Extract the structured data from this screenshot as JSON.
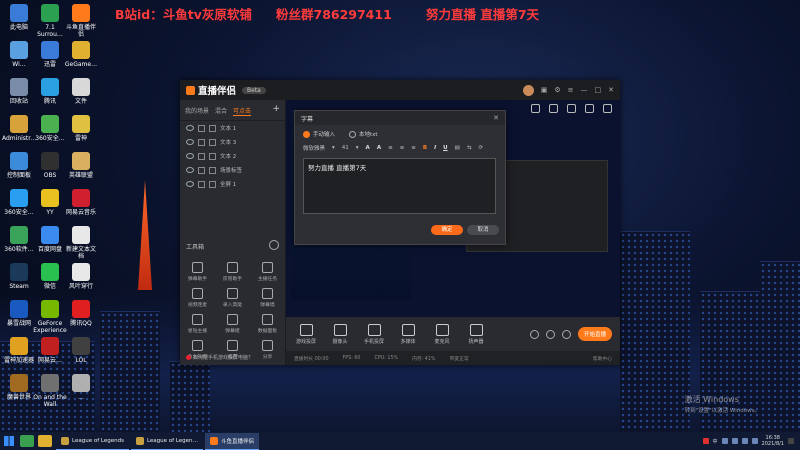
{
  "banner": {
    "text1": "B站id：斗鱼tv灰原软铺",
    "text2": "粉丝群786297411",
    "text3": "努力直播 直播第7天"
  },
  "desktop_icons": [
    {
      "label": "此电脑",
      "color": "#3b7bd8"
    },
    {
      "label": "Wi…",
      "color": "#5aa0e0"
    },
    {
      "label": "回收站",
      "color": "#7a8ca8"
    },
    {
      "label": "Administr…",
      "color": "#d8a23a"
    },
    {
      "label": "控制面板",
      "color": "#3b8bd8"
    },
    {
      "label": "360安全…",
      "color": "#2a9ef0"
    },
    {
      "label": "360软件…",
      "color": "#3aa35a"
    },
    {
      "label": "Steam",
      "color": "#1b3a5a"
    },
    {
      "label": "暴雪战网",
      "color": "#1a5ac0"
    },
    {
      "label": "雷神加速器",
      "color": "#e0a020"
    },
    {
      "label": "魔兽世界",
      "color": "#a06a20"
    },
    {
      "label": "7.1 Surrou…",
      "color": "#2aa050"
    },
    {
      "label": "迅雷",
      "color": "#3a7ad8"
    },
    {
      "label": "腾讯",
      "color": "#2aa0e0"
    },
    {
      "label": "360安全…",
      "color": "#4ab050"
    },
    {
      "label": "OBS",
      "color": "#303030"
    },
    {
      "label": "YY",
      "color": "#e8c020"
    },
    {
      "label": "百度网盘",
      "color": "#3a8af0"
    },
    {
      "label": "微信",
      "color": "#2ac050"
    },
    {
      "label": "GeForce Experience",
      "color": "#76b900"
    },
    {
      "label": "网易云…",
      "color": "#c02020"
    },
    {
      "label": "On and the Wall",
      "color": "#707070"
    },
    {
      "label": "斗鱼直播伴侣",
      "color": "#ff7a1a"
    },
    {
      "label": "GeGame…",
      "color": "#e0b030"
    },
    {
      "label": "文件",
      "color": "#d8d8d8"
    },
    {
      "label": "雷神",
      "color": "#e0c040"
    },
    {
      "label": "英雄联盟",
      "color": "#d8b060"
    },
    {
      "label": "网易云音乐",
      "color": "#d02030"
    },
    {
      "label": "新建文本文档",
      "color": "#e8e8e8"
    },
    {
      "label": "风叶穿行",
      "color": "#e8e8e8"
    },
    {
      "label": "腾讯QQ",
      "color": "#e02020"
    },
    {
      "label": "LOL",
      "color": "#404040"
    },
    {
      "label": "…",
      "color": "#b0b0b0"
    }
  ],
  "app": {
    "title": "直播伴侣",
    "badge": "Beta",
    "tabs": [
      "我的场景",
      "混合",
      "可点击"
    ],
    "add_tab": "+",
    "scenes": [
      "文本 1",
      "文本 3",
      "文本 2",
      "场景标签",
      "全屏 1"
    ],
    "tools_title": "工具箱",
    "tools": [
      "弹幕助手",
      "房管助手",
      "主播任务",
      "视频连麦",
      "录入高能",
      "弹幕墙",
      "星钻主播",
      "弹幕姬",
      "数据面板",
      "鱼丸礼物",
      "截图",
      "分享"
    ],
    "tip": "如何把手机游戏投屏电脑？",
    "bottom_buttons": [
      "游戏投屏",
      "摄像头",
      "手机投屏",
      "多媒体",
      "麦克风",
      "扬声器"
    ],
    "start_live": "开始直播",
    "status": [
      "直播时长 00:00",
      "FPS: 60",
      "CPU: 15%",
      "内存: 41%",
      "带宽正常"
    ],
    "status_right": "帮助中心"
  },
  "dialog": {
    "title": "字幕",
    "close": "✕",
    "radio_manual": "手动输入",
    "radio_local": "本地txt",
    "font_name": "微软雅黑",
    "font_size": "41",
    "text": "努力直播 直播第7天",
    "ok": "确定",
    "cancel": "取消"
  },
  "watermark": {
    "line1": "激活 Windows",
    "line2": "转到\"设置\"以激活 Windows。"
  },
  "taskbar": {
    "tasks": [
      {
        "label": "League of Legends",
        "color": "#c8a040",
        "active": false
      },
      {
        "label": "League of Legen…",
        "color": "#c8a040",
        "active": false
      },
      {
        "label": "斗鱼直播伴侣",
        "color": "#ff7a1a",
        "active": true
      }
    ],
    "ime": "中",
    "time": "16:38",
    "date": "2021/8/1"
  },
  "colors": {
    "accent": "#ff7a1a",
    "banner": "#ff3b3b"
  }
}
